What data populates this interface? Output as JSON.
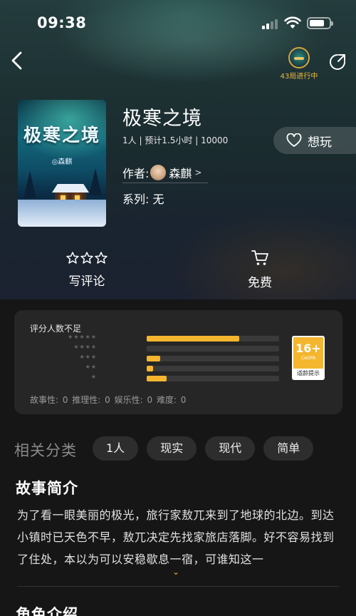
{
  "status_bar": {
    "time": "09:38"
  },
  "header": {
    "back_icon": "chevron-left-icon",
    "badge_text": "43局进行中",
    "share_icon": "share-icon"
  },
  "game": {
    "cover_title": "极寒之境",
    "cover_author": "◎森麒",
    "title": "极寒之境",
    "meta": "1人 | 预计1.5小时 | 10000",
    "author_label": "作者:",
    "author_name": "森麒",
    "author_chevron": ">",
    "series_label": "系列:",
    "series_value": "无",
    "wishlist_label": "想玩"
  },
  "actions": {
    "review_label": "写评论",
    "free_label": "免费"
  },
  "rating": {
    "title": "评分人数不足",
    "distribution": [
      {
        "stars": "★★★★★",
        "fraction": 0.7
      },
      {
        "stars": "★★★★",
        "fraction": 0.0
      },
      {
        "stars": "★★★",
        "fraction": 0.1
      },
      {
        "stars": "★★",
        "fraction": 0.05
      },
      {
        "stars": "★",
        "fraction": 0.15
      }
    ],
    "stats": "故事性: 0 推理性: 0 娱乐性: 0 难度: 0",
    "age_rating": "16+",
    "age_org": "CADPA",
    "age_tip": "适龄提示",
    "accent": "#f4b62e"
  },
  "categories": {
    "label": "相关分类",
    "tags": [
      "1人",
      "现实",
      "现代",
      "简单"
    ]
  },
  "synopsis": {
    "title": "故事简介",
    "text": "为了看一眼美丽的极光，旅行家敖兀来到了地球的北边。到达小镇时已天色不早，敖兀决定先找家旅店落脚。好不容易找到了住处，本以为可以安稳歇息一宿，可谁知这一",
    "expand_icon": "chevron-down-icon",
    "expand": "⌄"
  },
  "characters": {
    "title": "角色介绍"
  }
}
